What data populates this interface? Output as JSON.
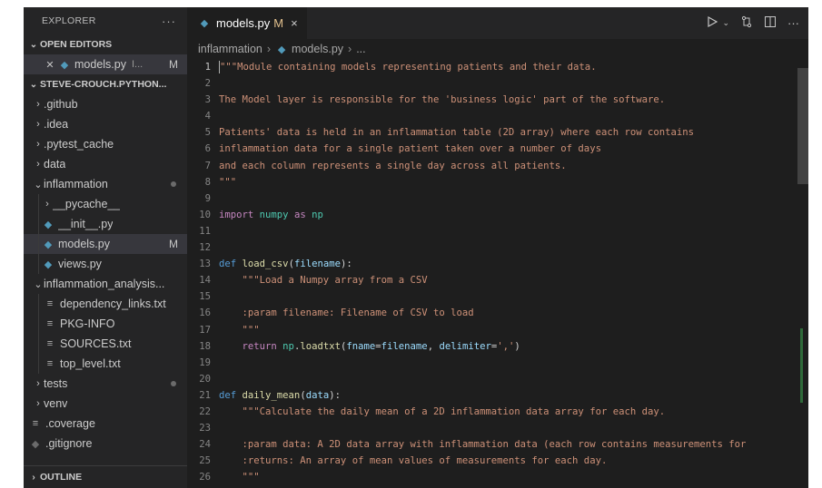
{
  "sidebar": {
    "title": "EXPLORER",
    "more": "···",
    "open_editors": {
      "label": "OPEN EDITORS",
      "file": "models.py",
      "path": "I...",
      "status": "M"
    },
    "project": "STEVE-CROUCH.PYTHON...",
    "items": [
      {
        "label": ".github"
      },
      {
        "label": ".idea"
      },
      {
        "label": ".pytest_cache"
      },
      {
        "label": "data"
      },
      {
        "label": "inflammation"
      },
      {
        "label": "__pycache__"
      },
      {
        "label": "__init__.py"
      },
      {
        "label": "models.py",
        "status": "M"
      },
      {
        "label": "views.py"
      },
      {
        "label": "inflammation_analysis..."
      },
      {
        "label": "dependency_links.txt"
      },
      {
        "label": "PKG-INFO"
      },
      {
        "label": "SOURCES.txt"
      },
      {
        "label": "top_level.txt"
      },
      {
        "label": "tests"
      },
      {
        "label": "venv"
      },
      {
        "label": ".coverage"
      },
      {
        "label": ".gitignore"
      }
    ],
    "outline": "OUTLINE"
  },
  "editor": {
    "tab": {
      "label": "models.py",
      "modified": "M",
      "close": "×"
    },
    "breadcrumb": {
      "folder": "inflammation",
      "file": "models.py",
      "more": "..."
    }
  },
  "code_lines": [
    {
      "n": "1",
      "t": [
        [
          "str",
          "\"\"\"Module containing models representing patients and their data."
        ]
      ]
    },
    {
      "n": "2",
      "t": []
    },
    {
      "n": "3",
      "t": [
        [
          "str",
          "The Model layer is responsible for the 'business logic' part of the software."
        ]
      ]
    },
    {
      "n": "4",
      "t": []
    },
    {
      "n": "5",
      "t": [
        [
          "str",
          "Patients' data is held in an inflammation table (2D array) where each row contains"
        ]
      ]
    },
    {
      "n": "6",
      "t": [
        [
          "str",
          "inflammation data for a single patient taken over a number of days"
        ]
      ]
    },
    {
      "n": "7",
      "t": [
        [
          "str",
          "and each column represents a single day across all patients."
        ]
      ]
    },
    {
      "n": "8",
      "t": [
        [
          "str",
          "\"\"\""
        ]
      ]
    },
    {
      "n": "9",
      "t": []
    },
    {
      "n": "10",
      "t": [
        [
          "kw2",
          "import"
        ],
        [
          "txt",
          " "
        ],
        [
          "mod2",
          "numpy"
        ],
        [
          "txt",
          " "
        ],
        [
          "kw2",
          "as"
        ],
        [
          "txt",
          " "
        ],
        [
          "mod2",
          "np"
        ]
      ]
    },
    {
      "n": "11",
      "t": []
    },
    {
      "n": "12",
      "t": []
    },
    {
      "n": "13",
      "t": [
        [
          "kw",
          "def"
        ],
        [
          "txt",
          " "
        ],
        [
          "fn",
          "load_csv"
        ],
        [
          "txt",
          "("
        ],
        [
          "var",
          "filename"
        ],
        [
          "txt",
          "):"
        ]
      ]
    },
    {
      "n": "14",
      "t": [
        [
          "str",
          "    \"\"\"Load a Numpy array from a CSV"
        ]
      ]
    },
    {
      "n": "15",
      "t": []
    },
    {
      "n": "16",
      "t": [
        [
          "str",
          "    :param filename: Filename of CSV to load"
        ]
      ]
    },
    {
      "n": "17",
      "t": [
        [
          "str",
          "    \"\"\""
        ]
      ]
    },
    {
      "n": "18",
      "t": [
        [
          "kw2",
          "    return"
        ],
        [
          "txt",
          " "
        ],
        [
          "mod2",
          "np"
        ],
        [
          "txt",
          "."
        ],
        [
          "fn",
          "loadtxt"
        ],
        [
          "txt",
          "("
        ],
        [
          "var",
          "fname"
        ],
        [
          "txt",
          "="
        ],
        [
          "var",
          "filename"
        ],
        [
          "txt",
          ", "
        ],
        [
          "var",
          "delimiter"
        ],
        [
          "txt",
          "="
        ],
        [
          "str",
          "','"
        ],
        [
          "txt",
          ")"
        ]
      ]
    },
    {
      "n": "19",
      "t": []
    },
    {
      "n": "20",
      "t": []
    },
    {
      "n": "21",
      "t": [
        [
          "kw",
          "def"
        ],
        [
          "txt",
          " "
        ],
        [
          "fn",
          "daily_mean"
        ],
        [
          "txt",
          "("
        ],
        [
          "var",
          "data"
        ],
        [
          "txt",
          "):"
        ]
      ]
    },
    {
      "n": "22",
      "t": [
        [
          "str",
          "    \"\"\"Calculate the daily mean of a 2D inflammation data array for each day."
        ]
      ]
    },
    {
      "n": "23",
      "t": []
    },
    {
      "n": "24",
      "t": [
        [
          "str",
          "    :param data: A 2D data array with inflammation data (each row contains measurements for"
        ]
      ]
    },
    {
      "n": "25",
      "t": [
        [
          "str",
          "    :returns: An array of mean values of measurements for each day."
        ]
      ]
    },
    {
      "n": "26",
      "t": [
        [
          "str",
          "    \"\"\""
        ]
      ]
    }
  ]
}
